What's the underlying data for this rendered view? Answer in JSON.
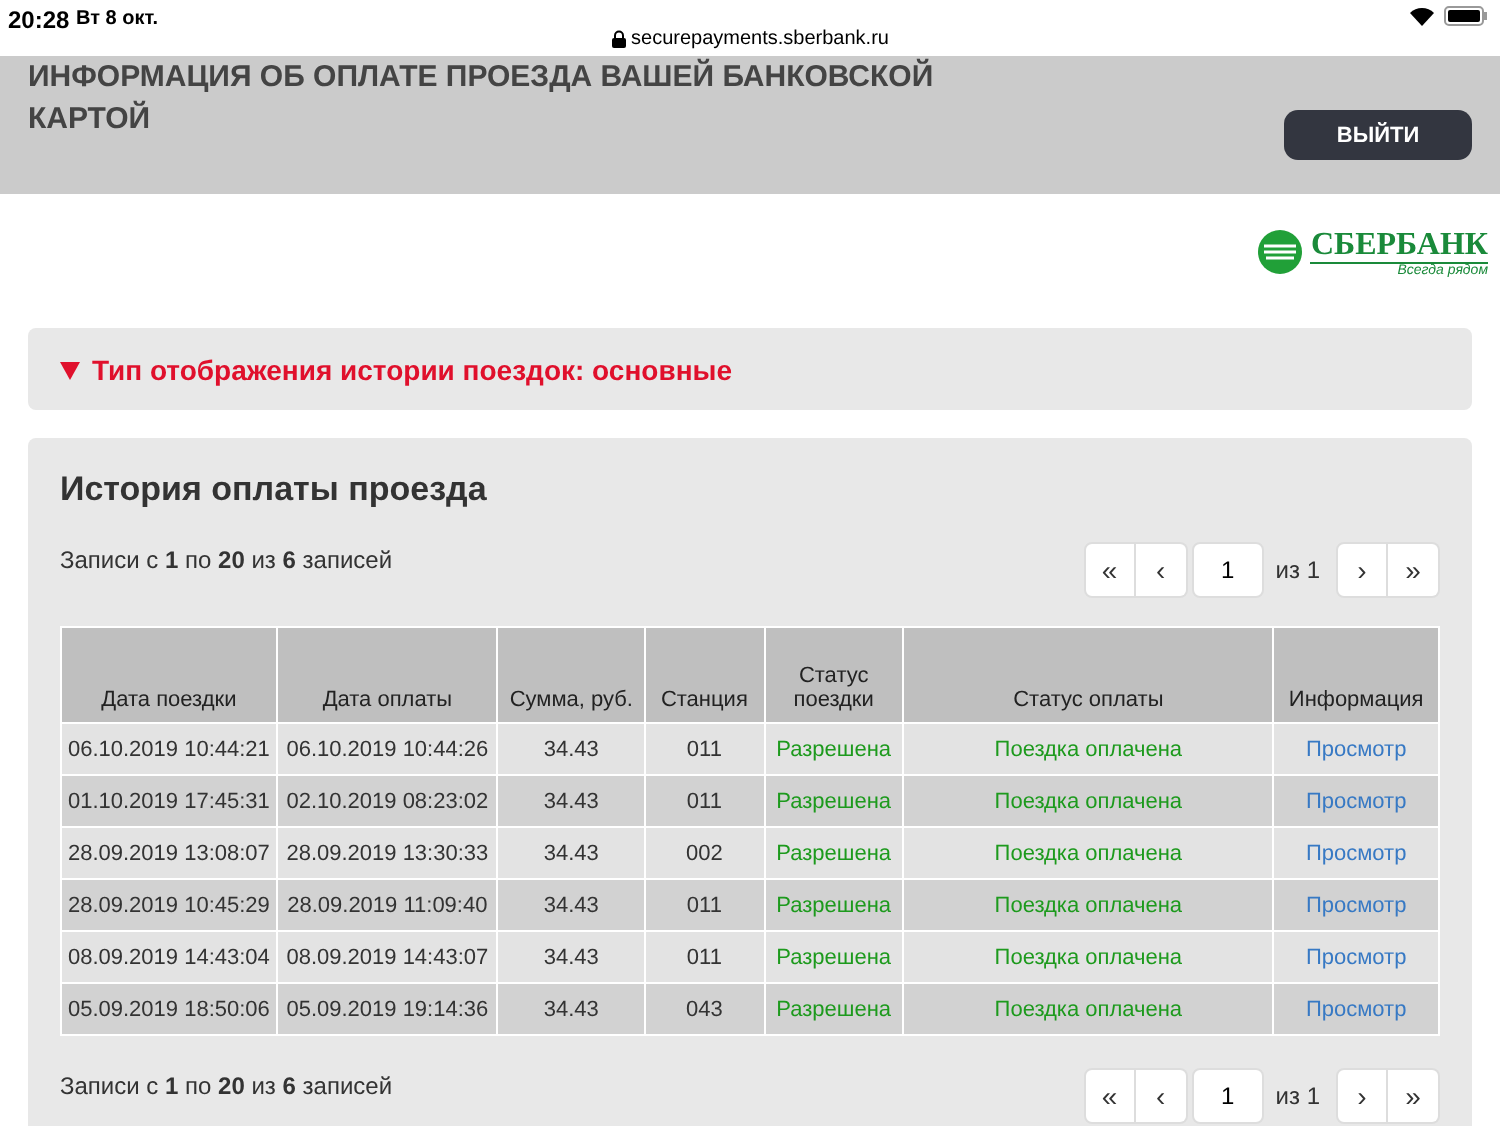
{
  "status_bar": {
    "time": "20:28",
    "date": "Вт 8 окт.",
    "url": "securepayments.sberbank.ru"
  },
  "header": {
    "title": "ИНФОРМАЦИЯ ОБ ОПЛАТЕ ПРОЕЗДА ВАШЕЙ БАНКОВСКОЙ КАРТОЙ",
    "logout_button": "ВЫЙТИ"
  },
  "logo": {
    "name": "СБЕРБАНК",
    "slogan": "Всегда рядом"
  },
  "view_toggle": {
    "label": "Тип отображения истории поездок: основные",
    "expanded": true
  },
  "panel": {
    "title": "История оплаты проезда",
    "records_top": "Записи с **1** по **20** из **6** записей",
    "pager_top": {
      "first": "«",
      "prev": "‹",
      "page": "1",
      "of": "из 1",
      "next": "›",
      "last": "»"
    },
    "table": {
      "columns": [
        "Дата поездки",
        "Дата оплаты",
        "Сумма, руб.",
        "Станция",
        "Статус поездки",
        "Статус оплаты",
        "Информация"
      ],
      "rows": [
        {
          "trip_date": "06.10.2019 10:44:21",
          "pay_date": "06.10.2019 10:44:26",
          "amount": "34.43",
          "station": "011",
          "trip_status": "Разрешена",
          "pay_status": "Поездка оплачена",
          "info": "Просмотр"
        },
        {
          "trip_date": "01.10.2019 17:45:31",
          "pay_date": "02.10.2019 08:23:02",
          "amount": "34.43",
          "station": "011",
          "trip_status": "Разрешена",
          "pay_status": "Поездка оплачена",
          "info": "Просмотр"
        },
        {
          "trip_date": "28.09.2019 13:08:07",
          "pay_date": "28.09.2019 13:30:33",
          "amount": "34.43",
          "station": "002",
          "trip_status": "Разрешена",
          "pay_status": "Поездка оплачена",
          "info": "Просмотр"
        },
        {
          "trip_date": "28.09.2019 10:45:29",
          "pay_date": "28.09.2019 11:09:40",
          "amount": "34.43",
          "station": "011",
          "trip_status": "Разрешена",
          "pay_status": "Поездка оплачена",
          "info": "Просмотр"
        },
        {
          "trip_date": "08.09.2019 14:43:04",
          "pay_date": "08.09.2019 14:43:07",
          "amount": "34.43",
          "station": "011",
          "trip_status": "Разрешена",
          "pay_status": "Поездка оплачена",
          "info": "Просмотр"
        },
        {
          "trip_date": "05.09.2019 18:50:06",
          "pay_date": "05.09.2019 19:14:36",
          "amount": "34.43",
          "station": "043",
          "trip_status": "Разрешена",
          "pay_status": "Поездка оплачена",
          "info": "Просмотр"
        }
      ]
    },
    "records_bottom": "Записи с **1** по **20** из **6** записей",
    "pager_bottom": {
      "first": "«",
      "prev": "‹",
      "page": "1",
      "of": "из 1",
      "next": "›",
      "last": "»"
    }
  }
}
